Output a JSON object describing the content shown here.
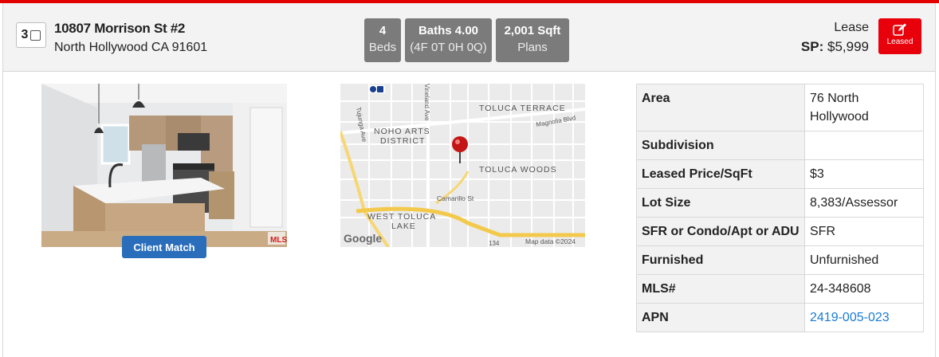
{
  "listing": {
    "index": "3",
    "address_line1": "10807 Morrison St #2",
    "address_line2": "North Hollywood CA 91601"
  },
  "stats": {
    "beds_value": "4",
    "beds_label": "Beds",
    "baths_value": "Baths 4.00",
    "baths_detail": "(4F 0T 0H 0Q)",
    "sqft_value": "2,001 Sqft",
    "plans_label": "Plans"
  },
  "price": {
    "type": "Lease",
    "sp_label": "SP:",
    "sp_value": "$5,999"
  },
  "status_button": {
    "label": "Leased",
    "icon": "edit-icon"
  },
  "client_match_label": "Client Match",
  "map": {
    "labels": {
      "toluca_terrace": "TOLUCA TERRACE",
      "noho1": "NOHO ARTS",
      "noho2": "DISTRICT",
      "magnolia": "Magnolia Blvd",
      "toluca_woods": "TOLUCA WOODS",
      "camarillo": "Camarillo St",
      "wtl1": "WEST TOLUCA",
      "wtl2": "LAKE",
      "tujunga": "Tujunga Ave",
      "vineland": "Vineland Ave",
      "route": "134",
      "google": "Google",
      "copyright": "Map data ©2024"
    }
  },
  "details": [
    {
      "label": "Area",
      "value": "76 North Hollywood"
    },
    {
      "label": "Subdivision",
      "value": ""
    },
    {
      "label": "Leased Price/SqFt",
      "value": "$3"
    },
    {
      "label": "Lot Size",
      "value": "8,383/Assessor"
    },
    {
      "label": "SFR or Condo/Apt or ADU",
      "value": "SFR"
    },
    {
      "label": "Furnished",
      "value": "Unfurnished"
    },
    {
      "label": "MLS#",
      "value": "24-348608"
    },
    {
      "label": "APN",
      "value": "2419-005-023"
    }
  ],
  "colors": {
    "accent_red": "#e30000",
    "button_blue": "#2a6ebb",
    "link_blue": "#1a7bd3",
    "pill_gray": "#7b7b7b"
  }
}
